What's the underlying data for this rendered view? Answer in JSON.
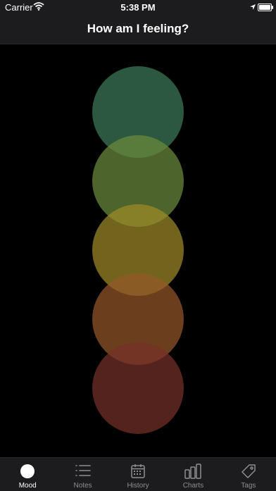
{
  "status_bar": {
    "carrier": "Carrier",
    "time": "5:38 PM"
  },
  "nav": {
    "title": "How am I feeling?"
  },
  "moods": [
    {
      "name": "mood-circle-1",
      "color": "#3d7a58"
    },
    {
      "name": "mood-circle-2",
      "color": "#6b8a3d"
    },
    {
      "name": "mood-circle-3",
      "color": "#a08a28"
    },
    {
      "name": "mood-circle-4",
      "color": "#94572a"
    },
    {
      "name": "mood-circle-5",
      "color": "#763028"
    }
  ],
  "tabs": [
    {
      "label": "Mood",
      "icon": "circle-icon",
      "active": true
    },
    {
      "label": "Notes",
      "icon": "list-icon",
      "active": false
    },
    {
      "label": "History",
      "icon": "calendar-icon",
      "active": false
    },
    {
      "label": "Charts",
      "icon": "bar-chart-icon",
      "active": false
    },
    {
      "label": "Tags",
      "icon": "tag-icon",
      "active": false
    }
  ]
}
